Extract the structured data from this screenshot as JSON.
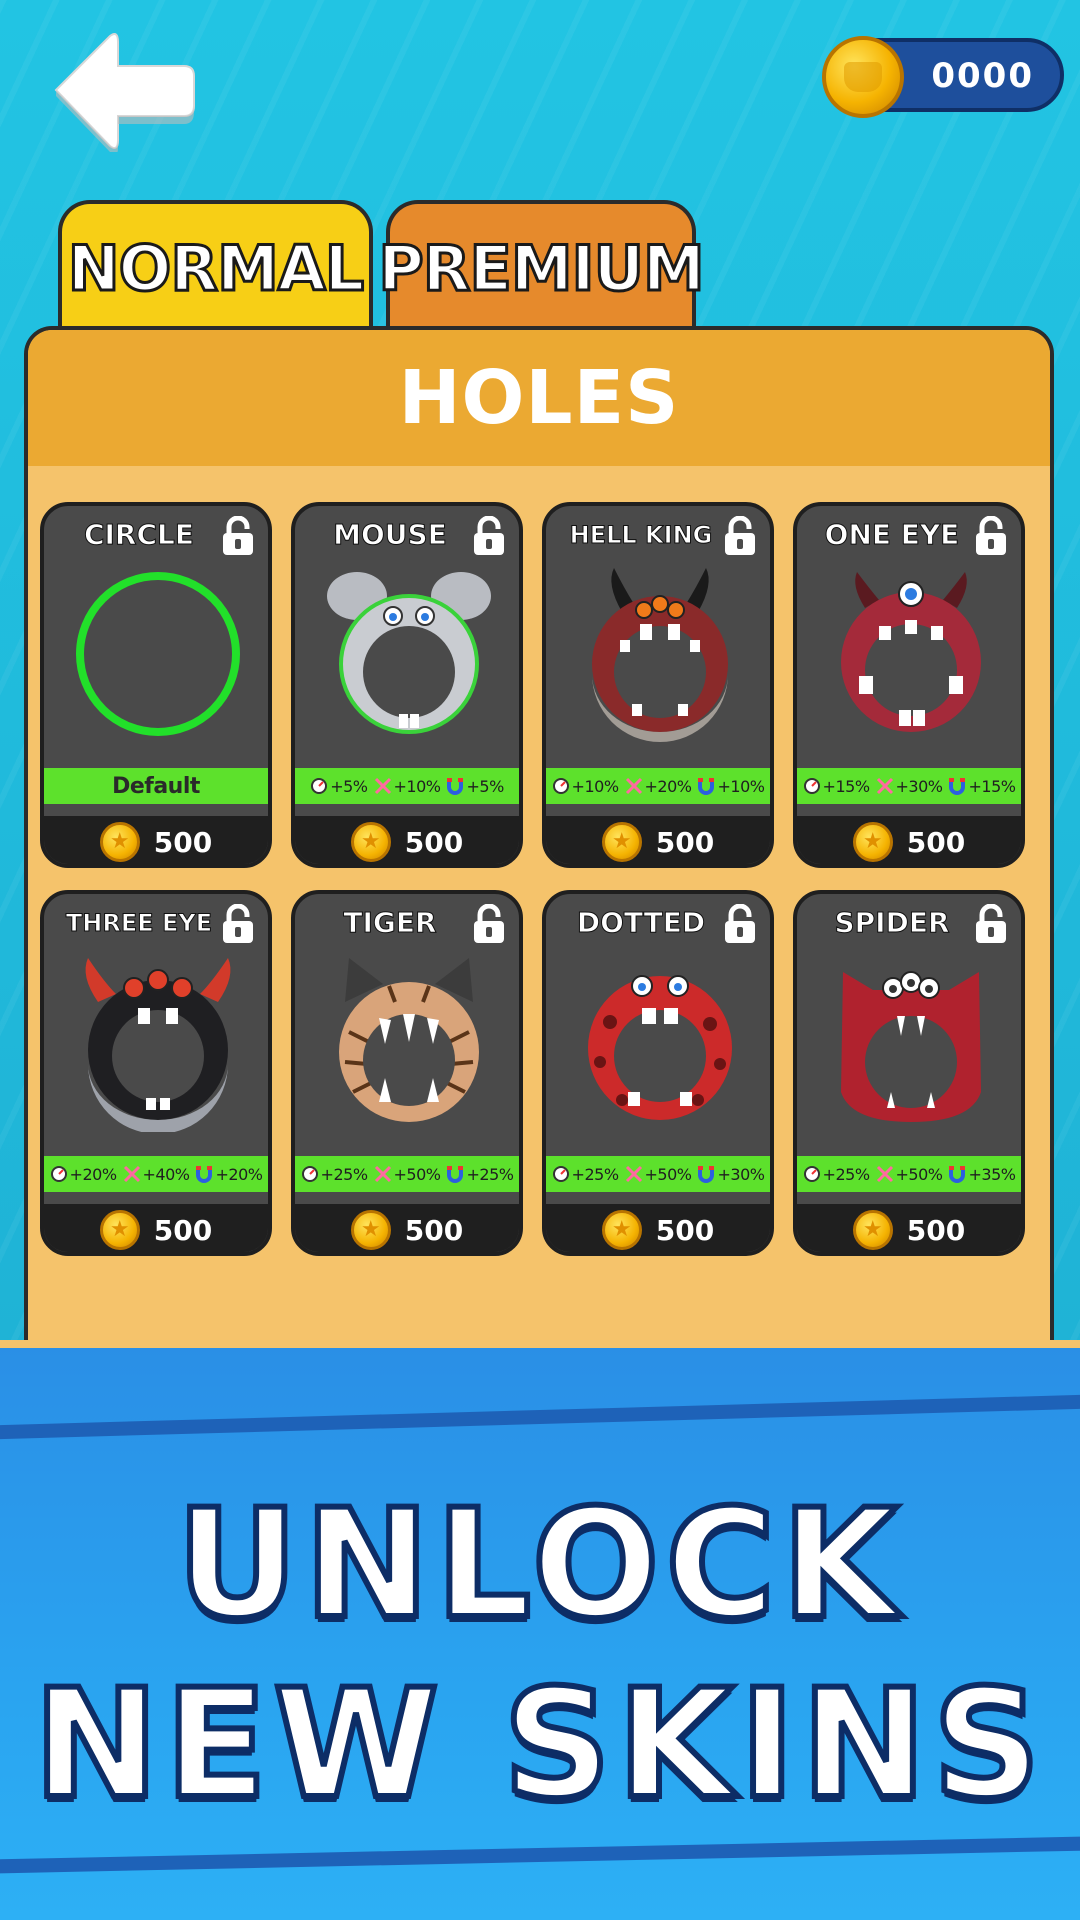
{
  "header": {
    "coin_count": "0000"
  },
  "tabs": [
    {
      "label": "NORMAL",
      "active": true,
      "color": "#f7cf16"
    },
    {
      "label": "PREMIUM",
      "active": false,
      "color": "#e68a2c"
    }
  ],
  "panel": {
    "title": "HOLES"
  },
  "skins": [
    {
      "name": "CIRCLE",
      "stats": {
        "speed": "",
        "size": "",
        "magnet": ""
      },
      "default_label": "Default",
      "price": "500"
    },
    {
      "name": "MOUSE",
      "stats": {
        "speed": "+5%",
        "size": "+10%",
        "magnet": "+5%"
      },
      "price": "500"
    },
    {
      "name": "HELL KING",
      "stats": {
        "speed": "+10%",
        "size": "+20%",
        "magnet": "+10%"
      },
      "price": "500"
    },
    {
      "name": "ONE EYE",
      "stats": {
        "speed": "+15%",
        "size": "+30%",
        "magnet": "+15%"
      },
      "price": "500"
    },
    {
      "name": "THREE EYE",
      "stats": {
        "speed": "+20%",
        "size": "+40%",
        "magnet": "+20%"
      },
      "price": "500"
    },
    {
      "name": "TIGER",
      "stats": {
        "speed": "+25%",
        "size": "+50%",
        "magnet": "+25%"
      },
      "price": "500"
    },
    {
      "name": "DOTTED",
      "stats": {
        "speed": "+25%",
        "size": "+50%",
        "magnet": "+30%"
      },
      "price": "500"
    },
    {
      "name": "SPIDER",
      "stats": {
        "speed": "+25%",
        "size": "+50%",
        "magnet": "+35%"
      },
      "price": "500"
    }
  ],
  "promo": {
    "line1": "UNLOCK",
    "line2": "NEW SKINS"
  },
  "icons": {
    "back": "back-arrow-icon",
    "coin": "coin-icon",
    "lock": "lock-icon",
    "speed": "speedometer-icon",
    "size": "expand-icon",
    "magnet": "magnet-icon"
  },
  "colors": {
    "background": "#1fb5d6",
    "panel": "#f5c36b",
    "panel_header": "#eba932",
    "card": "#4a4a4a",
    "stat_bar": "#5de12c",
    "banner": "#2a8fe6"
  }
}
